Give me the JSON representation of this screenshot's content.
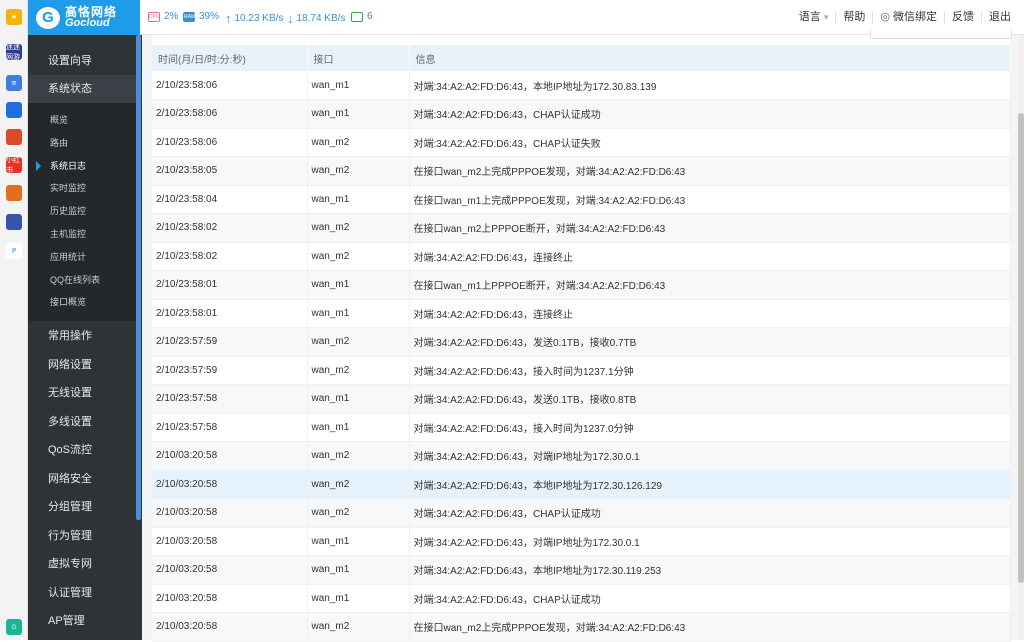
{
  "dock": {
    "items": [
      {
        "icon": "star-icon",
        "color": "#f5b400",
        "text": "★"
      },
      {
        "icon": "app-icon",
        "color": "#2c3e8f",
        "text": "迷迷网游"
      },
      {
        "icon": "doc-icon",
        "color": "#3f7fe0",
        "text": "≡"
      },
      {
        "icon": "chat-icon",
        "color": "#1e6fe0",
        "text": ""
      },
      {
        "icon": "game-icon",
        "color": "#d94a2a",
        "text": ""
      },
      {
        "icon": "shop-icon",
        "color": "#e8302a",
        "text": "小红书"
      },
      {
        "icon": "game2-icon",
        "color": "#e07020",
        "text": ""
      },
      {
        "icon": "game3-icon",
        "color": "#3355aa",
        "text": ""
      },
      {
        "icon": "p-icon",
        "color": "#ffffff",
        "text": "P"
      },
      {
        "icon": "bottom-app-icon",
        "color": "#1ab394",
        "text": "⊙"
      }
    ]
  },
  "logo": {
    "cn": "高恪网络",
    "en": "Gocloud",
    "mark": "G"
  },
  "status": {
    "cpu_chip": "CPU",
    "cpu": "2%",
    "ram_chip": "RAM",
    "ram": "39%",
    "up": "10.23 KB/s",
    "down": "18.74 KB/s",
    "online": "6"
  },
  "topnav": {
    "language": "语言",
    "help": "帮助",
    "wechat": "微信绑定",
    "feedback": "反馈",
    "logout": "退出"
  },
  "sidebar": {
    "groups_top": [
      {
        "label": "设置向导"
      },
      {
        "label": "系统状态"
      }
    ],
    "sub_items": [
      {
        "label": "概览"
      },
      {
        "label": "路由"
      },
      {
        "label": "系统日志"
      },
      {
        "label": "实时监控"
      },
      {
        "label": "历史监控"
      },
      {
        "label": "主机监控"
      },
      {
        "label": "应用统计"
      },
      {
        "label": "QQ在线列表"
      },
      {
        "label": "接口概览"
      }
    ],
    "groups_bottom": [
      {
        "label": "常用操作"
      },
      {
        "label": "网络设置"
      },
      {
        "label": "无线设置"
      },
      {
        "label": "多线设置"
      },
      {
        "label": "QoS流控"
      },
      {
        "label": "网络安全"
      },
      {
        "label": "分组管理"
      },
      {
        "label": "行为管理"
      },
      {
        "label": "虚拟专网"
      },
      {
        "label": "认证管理"
      },
      {
        "label": "AP管理"
      }
    ]
  },
  "log_table": {
    "headers": [
      "时间(月/日/时:分:秒)",
      "接口",
      "信息"
    ],
    "rows": [
      [
        "2/10/23:58:06",
        "wan_m1",
        "对端:34:A2:A2:FD:D6:43，本地IP地址为172.30.83.139"
      ],
      [
        "2/10/23:58:06",
        "wan_m1",
        "对端:34:A2:A2:FD:D6:43，CHAP认证成功"
      ],
      [
        "2/10/23:58:06",
        "wan_m2",
        "对端:34:A2:A2:FD:D6:43，CHAP认证失败"
      ],
      [
        "2/10/23:58:05",
        "wan_m2",
        "在接口wan_m2上完成PPPOE发现，对端:34:A2:A2:FD:D6:43"
      ],
      [
        "2/10/23:58:04",
        "wan_m1",
        "在接口wan_m1上完成PPPOE发现，对端:34:A2:A2:FD:D6:43"
      ],
      [
        "2/10/23:58:02",
        "wan_m2",
        "在接口wan_m2上PPPOE断开，对端:34:A2:A2:FD:D6:43"
      ],
      [
        "2/10/23:58:02",
        "wan_m2",
        "对端:34:A2:A2:FD:D6:43，连接终止"
      ],
      [
        "2/10/23:58:01",
        "wan_m1",
        "在接口wan_m1上PPPOE断开，对端:34:A2:A2:FD:D6:43"
      ],
      [
        "2/10/23:58:01",
        "wan_m1",
        "对端:34:A2:A2:FD:D6:43，连接终止"
      ],
      [
        "2/10/23:57:59",
        "wan_m2",
        "对端:34:A2:A2:FD:D6:43，发送0.1TB，接收0.7TB"
      ],
      [
        "2/10/23:57:59",
        "wan_m2",
        "对端:34:A2:A2:FD:D6:43，接入时间为1237.1分钟"
      ],
      [
        "2/10/23:57:58",
        "wan_m1",
        "对端:34:A2:A2:FD:D6:43，发送0.1TB，接收0.8TB"
      ],
      [
        "2/10/23:57:58",
        "wan_m1",
        "对端:34:A2:A2:FD:D6:43，接入时间为1237.0分钟"
      ],
      [
        "2/10/03:20:58",
        "wan_m2",
        "对端:34:A2:A2:FD:D6:43，对端IP地址为172.30.0.1"
      ],
      [
        "2/10/03:20:58",
        "wan_m2",
        "对端:34:A2:A2:FD:D6:43，本地IP地址为172.30.126.129"
      ],
      [
        "2/10/03:20:58",
        "wan_m2",
        "对端:34:A2:A2:FD:D6:43，CHAP认证成功"
      ],
      [
        "2/10/03:20:58",
        "wan_m1",
        "对端:34:A2:A2:FD:D6:43，对端IP地址为172.30.0.1"
      ],
      [
        "2/10/03:20:58",
        "wan_m1",
        "对端:34:A2:A2:FD:D6:43，本地IP地址为172.30.119.253"
      ],
      [
        "2/10/03:20:58",
        "wan_m1",
        "对端:34:A2:A2:FD:D6:43，CHAP认证成功"
      ],
      [
        "2/10/03:20:58",
        "wan_m2",
        "在接口wan_m2上完成PPPOE发现，对端:34:A2:A2:FD:D6:43"
      ]
    ]
  },
  "colors": {
    "brand": "#1e9be9",
    "sidebar": "#2e3338",
    "header_row": "#e8f2fb",
    "highlight_row": "#e5f2fc"
  }
}
